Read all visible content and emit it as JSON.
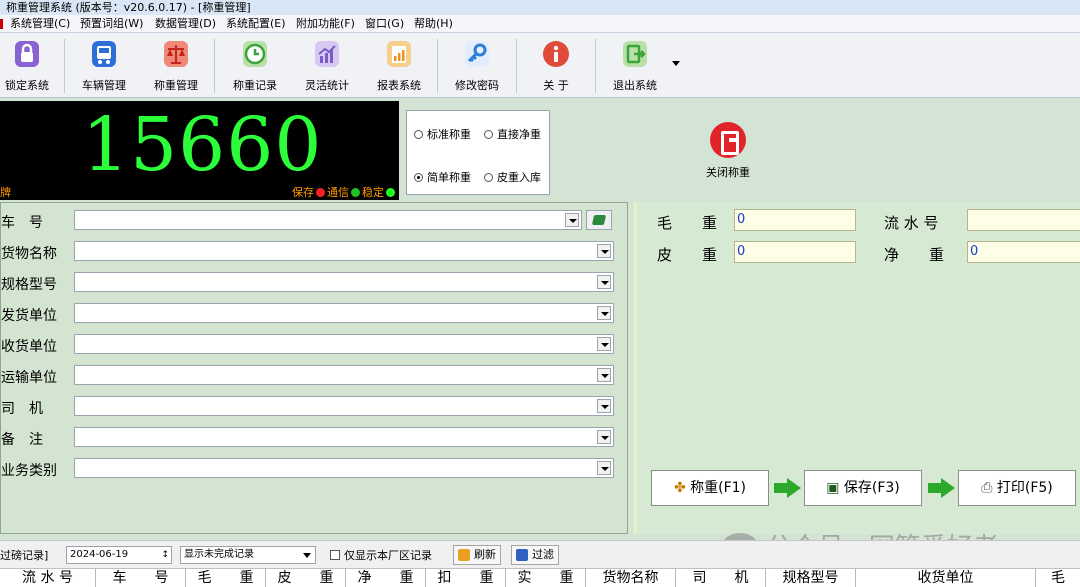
{
  "window": {
    "title": "称重管理系统 (版本号：v20.6.0.17) - [称重管理]"
  },
  "menu": [
    "系统管理(C)",
    "预置词组(W)",
    "数据管理(D)",
    "系统配置(E)",
    "附加功能(F)",
    "窗口(G)",
    "帮助(H)"
  ],
  "toolbar": [
    {
      "label": "锁定系统",
      "icon": "lock-icon",
      "color": "#7b52c7"
    },
    {
      "label": "车辆管理",
      "icon": "bus-icon",
      "color": "#2d6fd6"
    },
    {
      "label": "称重管理",
      "icon": "scale-icon",
      "color": "#e04a3a"
    },
    {
      "label": "称重记录",
      "icon": "clock-icon",
      "color": "#3ca33c"
    },
    {
      "label": "灵活统计",
      "icon": "chart-icon",
      "color": "#7b5bc7"
    },
    {
      "label": "报表系统",
      "icon": "report-icon",
      "color": "#f0a030"
    },
    {
      "label": "修改密码",
      "icon": "key-icon",
      "color": "#2d7fd6"
    },
    {
      "label": "关 于",
      "icon": "info-icon",
      "color": "#e04a3a"
    },
    {
      "label": "退出系统",
      "icon": "exit-icon",
      "color": "#3ca33c"
    }
  ],
  "weight": {
    "value": "15660",
    "status_left": "牌",
    "status_save": "保存",
    "status_comm": "通信",
    "status_stable": "稳定",
    "led_colors": [
      "#ff2020",
      "#20c020",
      "#20ff20"
    ]
  },
  "modes": [
    {
      "label": "标准称重",
      "selected": false
    },
    {
      "label": "直接净重",
      "selected": false
    },
    {
      "label": "简单称重",
      "selected": true
    },
    {
      "label": "皮重入库",
      "selected": false
    }
  ],
  "close_weighing": "关闭称重",
  "form": [
    {
      "label": "车　号",
      "value": ""
    },
    {
      "label": "货物名称",
      "value": ""
    },
    {
      "label": "规格型号",
      "value": ""
    },
    {
      "label": "发货单位",
      "value": ""
    },
    {
      "label": "收货单位",
      "value": ""
    },
    {
      "label": "运输单位",
      "value": ""
    },
    {
      "label": "司　机",
      "value": ""
    },
    {
      "label": "备　注",
      "value": ""
    },
    {
      "label": "业务类别",
      "value": ""
    }
  ],
  "right": {
    "gross_label": "毛　　重",
    "gross_value": "0",
    "tare_label": "皮　　重",
    "tare_value": "0",
    "serial_label": "流 水 号",
    "serial_value": "",
    "net_label": "净　　重",
    "net_value": "0"
  },
  "actions": {
    "weigh": "称重(F1)",
    "save": "保存(F3)",
    "print": "打印(F5)"
  },
  "filter": {
    "label": "过磅记录]",
    "date": "2024-06-19",
    "select": "显示未完成记录",
    "only_local": "仅显示本厂区记录",
    "refresh": "刷新",
    "filter_btn": "过滤"
  },
  "table": {
    "headers": [
      "流 水 号",
      "车　　号",
      "毛　　重",
      "皮　　重",
      "净　　重",
      "扣　　重",
      "实　　重",
      "货物名称",
      "司　　机",
      "规格型号",
      "收货单位",
      "毛"
    ]
  },
  "watermark": "公众号 · 网管爱好者"
}
